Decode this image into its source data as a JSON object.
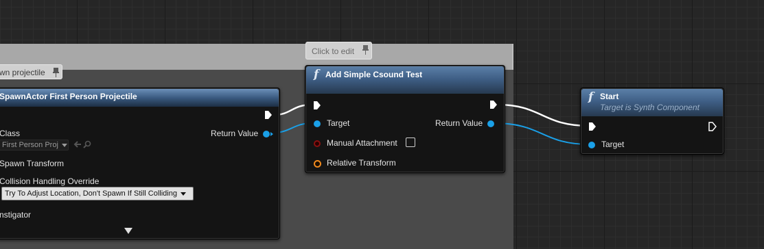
{
  "comment": {
    "title_fragment": "wn projectile",
    "edit_bubble": "Click to edit"
  },
  "spawn_node": {
    "title": "SpawnActor First Person Projectile",
    "class_label": "Class",
    "class_value": "First Person Proj",
    "spawn_transform_label": "Spawn Transform",
    "collision_label": "Collision Handling Override",
    "collision_value": "Try To Adjust Location, Don't Spawn If Still Colliding",
    "instigator_label": "nstigator",
    "return_value_label": "Return Value"
  },
  "csound_node": {
    "title": "Add Simple Csound Test",
    "target_label": "Target",
    "manual_attachment_label": "Manual Attachment",
    "relative_transform_label": "Relative Transform",
    "return_value_label": "Return Value",
    "manual_attachment_checked": false
  },
  "start_node": {
    "title": "Start",
    "subtitle": "Target is Synth Component",
    "target_label": "Target"
  },
  "colors": {
    "object_pin": "#1aa0e8",
    "exec_pin": "#ffffff",
    "transform_pin": "#f08a1e",
    "attachment_pin": "#8a1010"
  },
  "icons": [
    "function-icon",
    "pin-icon",
    "exec-pin-icon",
    "browse-arrow-icon",
    "search-icon",
    "chevron-down-icon"
  ]
}
